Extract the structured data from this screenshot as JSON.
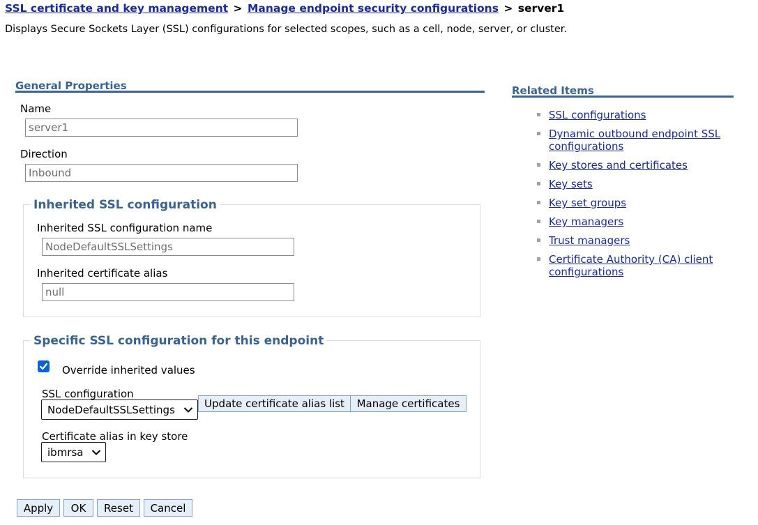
{
  "breadcrumb": {
    "link1": "SSL certificate and key management",
    "sep1": ">",
    "link2": "Manage endpoint security configurations",
    "sep2": ">",
    "current": "server1"
  },
  "description": "Displays Secure Sockets Layer (SSL) configurations for selected scopes, such as a cell, node, server, or cluster.",
  "general": {
    "title": "General Properties",
    "name_label": "Name",
    "name_value": "server1",
    "direction_label": "Direction",
    "direction_value": "Inbound"
  },
  "inherited": {
    "legend": "Inherited SSL configuration",
    "config_name_label": "Inherited SSL configuration name",
    "config_name_value": "NodeDefaultSSLSettings",
    "alias_label": "Inherited certificate alias",
    "alias_value": "null"
  },
  "specific": {
    "legend": "Specific SSL configuration for this endpoint",
    "override_label": "Override inherited values",
    "override_checked": true,
    "ssl_config_label": "SSL configuration",
    "ssl_config_selected": "NodeDefaultSSLSettings",
    "update_alias_button": "Update certificate alias list",
    "manage_certs_button": "Manage certificates",
    "alias_label": "Certificate alias in key store",
    "alias_selected": "ibmrsa"
  },
  "actions": {
    "apply": "Apply",
    "ok": "OK",
    "reset": "Reset",
    "cancel": "Cancel"
  },
  "related": {
    "title": "Related Items",
    "items": [
      {
        "label": "SSL configurations"
      },
      {
        "label": "Dynamic outbound endpoint SSL configurations"
      },
      {
        "label": "Key stores and certificates"
      },
      {
        "label": "Key sets"
      },
      {
        "label": "Key set groups"
      },
      {
        "label": "Key managers"
      },
      {
        "label": "Trust managers"
      },
      {
        "label": "Certificate Authority (CA) client configurations"
      }
    ]
  },
  "colors": {
    "link": "#1a2a9a",
    "section": "#3a6391",
    "checkbox": "#0a63d6"
  },
  "icons": {
    "checkbox": "checkmark-icon",
    "dropdown": "chevron-down-icon",
    "bullet": "square-bullet-icon"
  }
}
